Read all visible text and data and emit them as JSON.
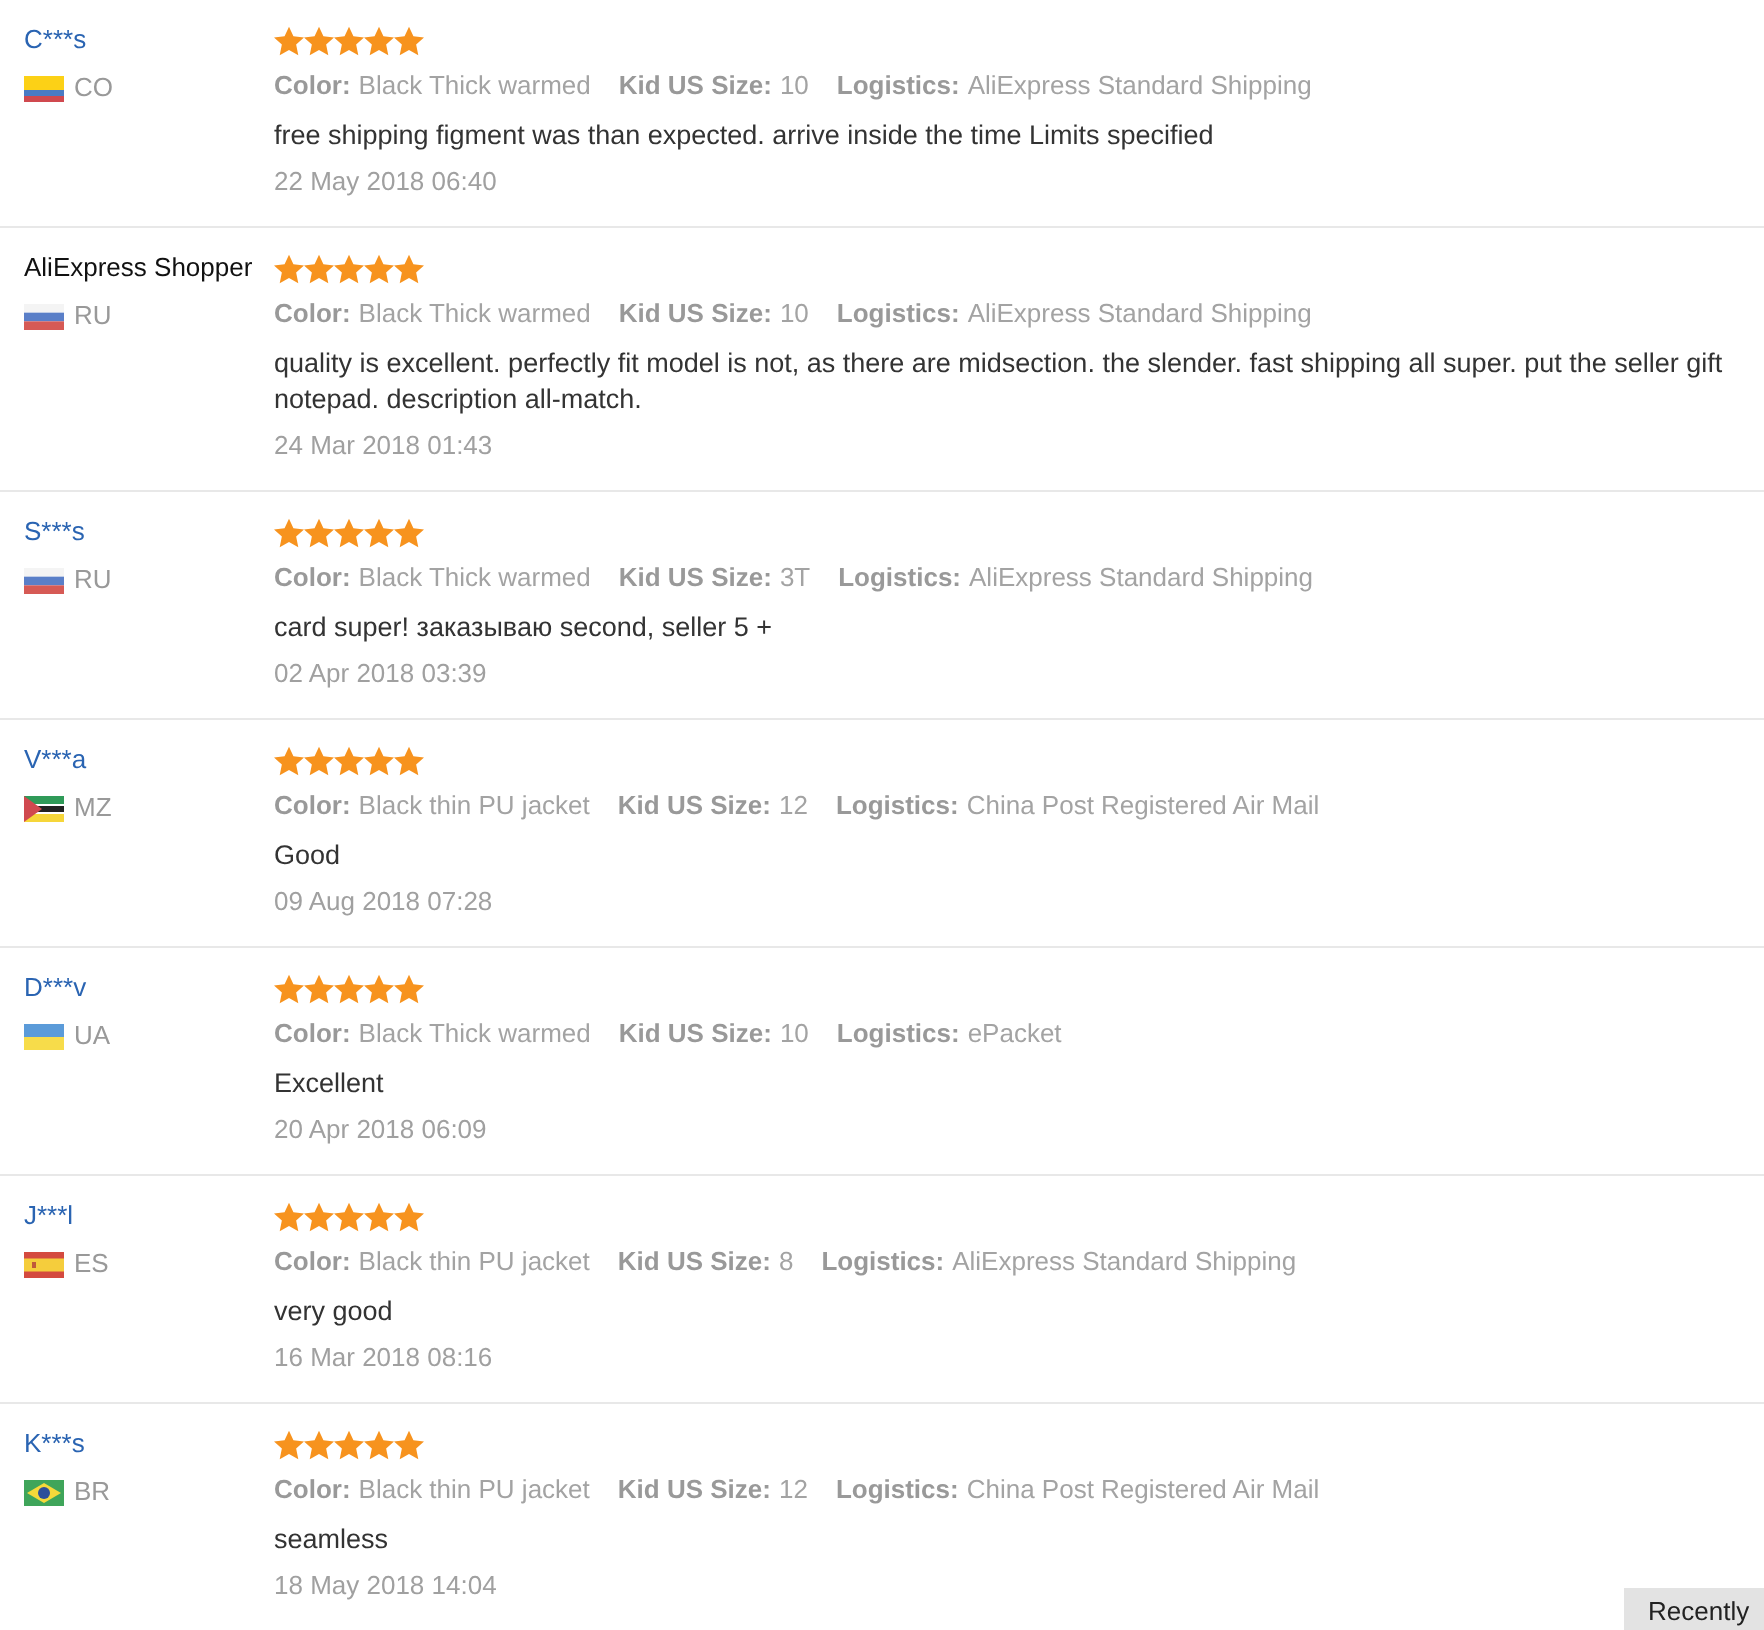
{
  "reviews": [
    {
      "name": "C***s",
      "link": true,
      "flag": {
        "kind": "co"
      },
      "country": "CO",
      "stars": 5,
      "attributes": [
        {
          "label": "Color:",
          "value": "Black Thick warmed"
        },
        {
          "label": "Kid US Size:",
          "value": "10"
        },
        {
          "label": "Logistics:",
          "value": "AliExpress Standard Shipping"
        }
      ],
      "text": "free shipping figment was than expected. arrive inside the time Limits specified",
      "date": "22 May 2018 06:40"
    },
    {
      "name": "AliExpress Shopper",
      "link": false,
      "flag": {
        "kind": "ru"
      },
      "country": "RU",
      "stars": 5,
      "attributes": [
        {
          "label": "Color:",
          "value": "Black Thick warmed"
        },
        {
          "label": "Kid US Size:",
          "value": "10"
        },
        {
          "label": "Logistics:",
          "value": "AliExpress Standard Shipping"
        }
      ],
      "text": "quality is excellent. perfectly fit model is not, as there are midsection. the slender. fast shipping all super. put the seller gift notepad. description all-match.",
      "date": "24 Mar 2018 01:43"
    },
    {
      "name": "S***s",
      "link": true,
      "flag": {
        "kind": "ru"
      },
      "country": "RU",
      "stars": 5,
      "attributes": [
        {
          "label": "Color:",
          "value": "Black Thick warmed"
        },
        {
          "label": "Kid US Size:",
          "value": "3T"
        },
        {
          "label": "Logistics:",
          "value": "AliExpress Standard Shipping"
        }
      ],
      "text": "card super! заказываю second, seller 5 +",
      "date": "02 Apr 2018 03:39"
    },
    {
      "name": "V***a",
      "link": true,
      "flag": {
        "kind": "mz"
      },
      "country": "MZ",
      "stars": 5,
      "attributes": [
        {
          "label": "Color:",
          "value": "Black thin PU jacket"
        },
        {
          "label": "Kid US Size:",
          "value": "12"
        },
        {
          "label": "Logistics:",
          "value": "China Post Registered Air Mail"
        }
      ],
      "text": "Good",
      "date": "09 Aug 2018 07:28"
    },
    {
      "name": "D***v",
      "link": true,
      "flag": {
        "kind": "ua"
      },
      "country": "UA",
      "stars": 5,
      "attributes": [
        {
          "label": "Color:",
          "value": "Black Thick warmed"
        },
        {
          "label": "Kid US Size:",
          "value": "10"
        },
        {
          "label": "Logistics:",
          "value": "ePacket"
        }
      ],
      "text": "Excellent",
      "date": "20 Apr 2018 06:09"
    },
    {
      "name": "J***l",
      "link": true,
      "flag": {
        "kind": "es"
      },
      "country": "ES",
      "stars": 5,
      "attributes": [
        {
          "label": "Color:",
          "value": "Black thin PU jacket"
        },
        {
          "label": "Kid US Size:",
          "value": "8"
        },
        {
          "label": "Logistics:",
          "value": "AliExpress Standard Shipping"
        }
      ],
      "text": "very good",
      "date": "16 Mar 2018 08:16"
    },
    {
      "name": "K***s",
      "link": true,
      "flag": {
        "kind": "br"
      },
      "country": "BR",
      "stars": 5,
      "attributes": [
        {
          "label": "Color:",
          "value": "Black thin PU jacket"
        },
        {
          "label": "Kid US Size:",
          "value": "12"
        },
        {
          "label": "Logistics:",
          "value": "China Post Registered Air Mail"
        }
      ],
      "text": "seamless",
      "date": "18 May 2018 14:04"
    }
  ],
  "float_button": {
    "label": "Recently"
  }
}
